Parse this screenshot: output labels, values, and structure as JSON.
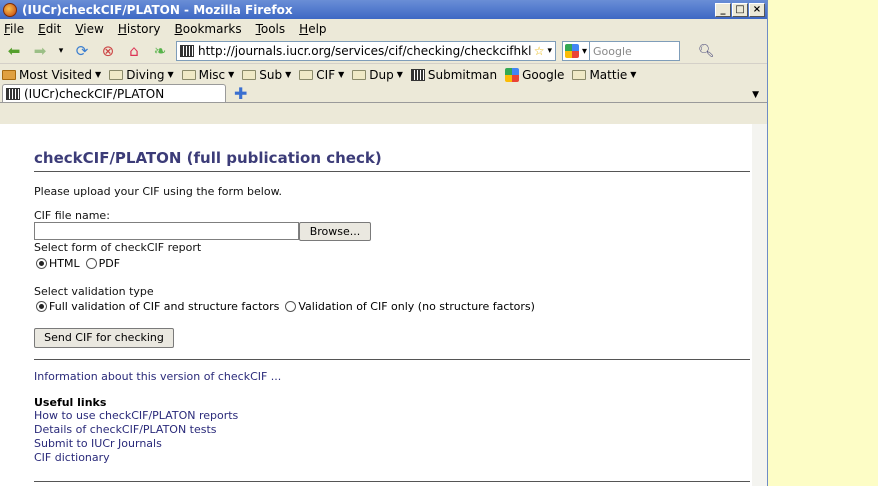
{
  "window": {
    "title": "(IUCr)checkCIF/PLATON - Mozilla Firefox",
    "buttons": [
      "_",
      "□",
      "×"
    ]
  },
  "menu": [
    "File",
    "Edit",
    "View",
    "History",
    "Bookmarks",
    "Tools",
    "Help"
  ],
  "nav": {
    "url": "http://journals.iucr.org/services/cif/checking/checkcifhkl.htm",
    "search_placeholder": "Google"
  },
  "bookmarks": [
    {
      "label": "Most Visited",
      "dropdown": true
    },
    {
      "label": "Diving",
      "dropdown": true
    },
    {
      "label": "Misc",
      "dropdown": true
    },
    {
      "label": "Sub",
      "dropdown": true
    },
    {
      "label": "CIF",
      "dropdown": true
    },
    {
      "label": "Dup",
      "dropdown": true
    },
    {
      "label": "Submitman",
      "dropdown": false
    },
    {
      "label": "Google",
      "dropdown": false
    },
    {
      "label": "Mattie",
      "dropdown": true
    }
  ],
  "tab": {
    "label": "(IUCr)checkCIF/PLATON"
  },
  "page": {
    "title": "checkCIF/PLATON (full publication check)",
    "intro": "Please upload your CIF using the form below.",
    "file_label": "CIF file name:",
    "browse_label": "Browse...",
    "report_label": "Select form of checkCIF report",
    "report_options": [
      {
        "label": "HTML",
        "selected": true
      },
      {
        "label": "PDF",
        "selected": false
      }
    ],
    "validation_label": "Select validation type",
    "validation_options": [
      {
        "label": "Full validation of CIF and structure factors",
        "selected": true
      },
      {
        "label": "Validation of CIF only (no structure factors)",
        "selected": false
      }
    ],
    "send_label": "Send CIF for checking",
    "info_link": "Information about this version of checkCIF ...",
    "useful_heading": "Useful links",
    "useful_links": [
      "How to use checkCIF/PLATON reports",
      "Details of checkCIF/PLATON tests",
      "Submit to IUCr Journals",
      "CIF dictionary"
    ]
  }
}
